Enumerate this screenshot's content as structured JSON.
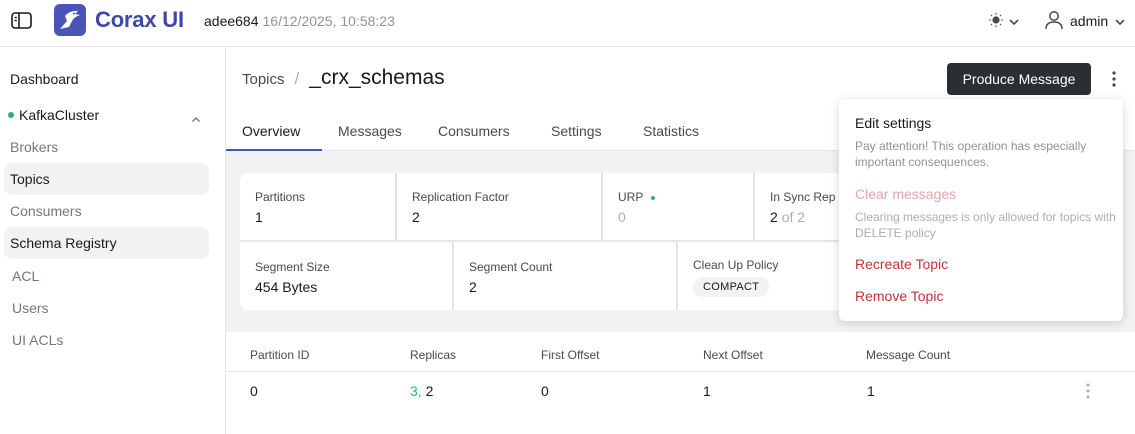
{
  "header": {
    "app_title": "Corax UI",
    "user": "adee684",
    "timestamp": "16/12/2025, 10:58:23",
    "admin_label": "admin",
    "icons": [
      "sidebar-toggle-icon",
      "raven-logo-icon",
      "sun-icon",
      "chevron-down-icon",
      "user-icon"
    ]
  },
  "sidebar": {
    "dashboard": "Dashboard",
    "cluster": "KafkaCluster",
    "items": [
      {
        "label": "Brokers"
      },
      {
        "label": "Topics"
      },
      {
        "label": "Consumers"
      },
      {
        "label": "Schema Registry"
      },
      {
        "label": "ACL"
      },
      {
        "label": "Users"
      },
      {
        "label": "UI ACLs"
      }
    ]
  },
  "breadcrumb": {
    "parent": "Topics",
    "separator": "/",
    "current": "_crx_schemas"
  },
  "actions": {
    "produce": "Produce Message"
  },
  "tabs": [
    "Overview",
    "Messages",
    "Consumers",
    "Settings",
    "Statistics"
  ],
  "stats": {
    "partitions": {
      "label": "Partitions",
      "value": "1"
    },
    "replication": {
      "label": "Replication Factor",
      "value": "2"
    },
    "urp": {
      "label": "URP",
      "value": "0"
    },
    "isr": {
      "label": "In Sync Rep",
      "value": "2",
      "of": "of 2"
    },
    "segment_size": {
      "label": "Segment Size",
      "value": "454 Bytes"
    },
    "segment_count": {
      "label": "Segment Count",
      "value": "2"
    },
    "cleanup": {
      "label": "Clean Up Policy",
      "value": "COMPACT"
    }
  },
  "table": {
    "headers": [
      "Partition ID",
      "Replicas",
      "First Offset",
      "Next Offset",
      "Message Count"
    ],
    "rows": [
      {
        "partition": "0",
        "replica_leader": "3,",
        "replica_other": "2",
        "first_offset": "0",
        "next_offset": "1",
        "message_count": "1"
      }
    ]
  },
  "menu": {
    "edit": "Edit settings",
    "edit_desc": "Pay attention! This operation has especially important consequences.",
    "clear": "Clear messages",
    "clear_desc": "Clearing messages is only allowed for topics with DELETE policy",
    "recreate": "Recreate Topic",
    "remove": "Remove Topic"
  },
  "colors": {
    "brand": "#4a53b8",
    "danger": "#c2333b",
    "success": "#2fb36b"
  }
}
